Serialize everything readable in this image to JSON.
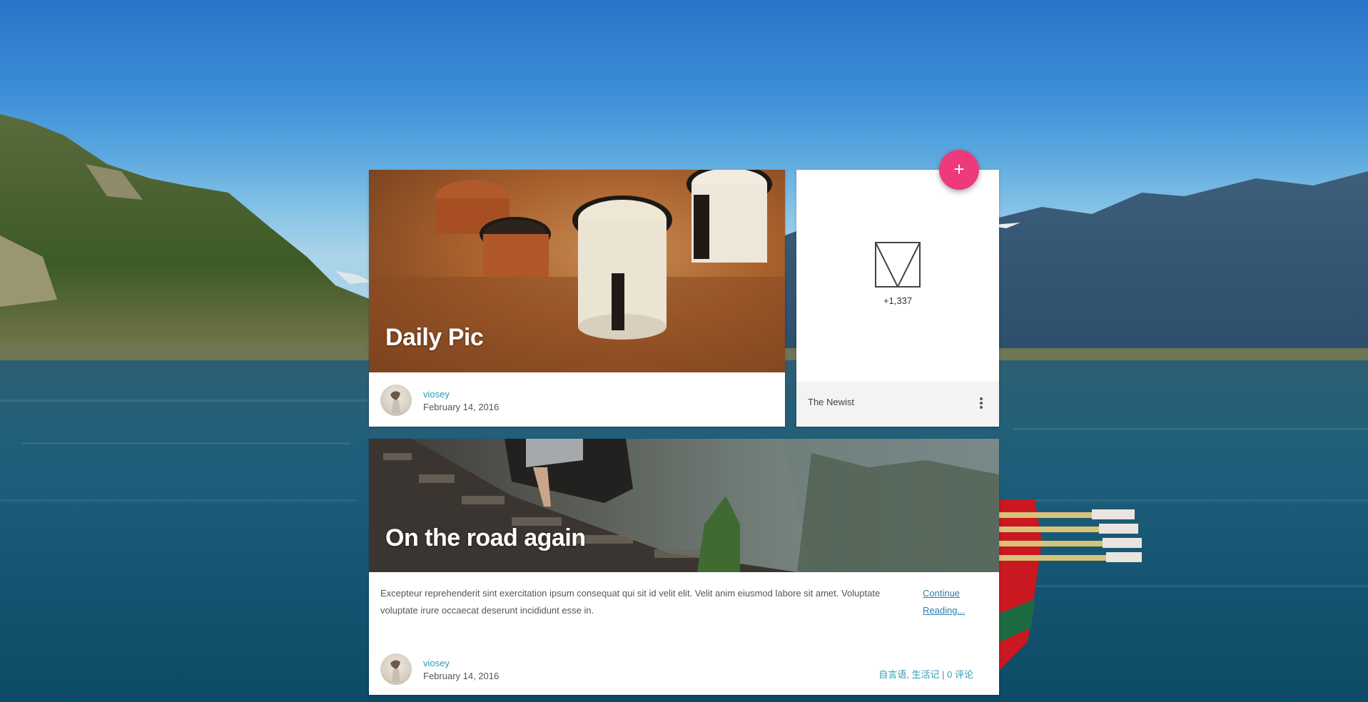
{
  "posts": [
    {
      "title": "Daily Pic",
      "author": "viosey",
      "date": "February 14, 2016"
    },
    {
      "title": "On the road again",
      "excerpt": "Excepteur reprehenderit sint exercitation ipsum consequat qui sit id velit elit. Velit anim eiusmod labore sit amet. Voluptate voluptate irure occaecat deserunt incididunt esse in.",
      "continue_label": "Continue Reading...",
      "author": "viosey",
      "date": "February 14, 2016",
      "categories": [
        "自言语",
        "生活记"
      ],
      "category_separator": ",",
      "meta_separator": "|",
      "comments": "0 评论"
    }
  ],
  "sidebar_card": {
    "count": "+1,337",
    "footer_label": "The Newist",
    "more_icon": "more-vert-icon"
  },
  "fab": {
    "label": "+",
    "icon": "plus-icon",
    "color": "#ee3a7a"
  },
  "colors": {
    "link": "#2b9bb7",
    "accent": "#ee3a7a"
  }
}
